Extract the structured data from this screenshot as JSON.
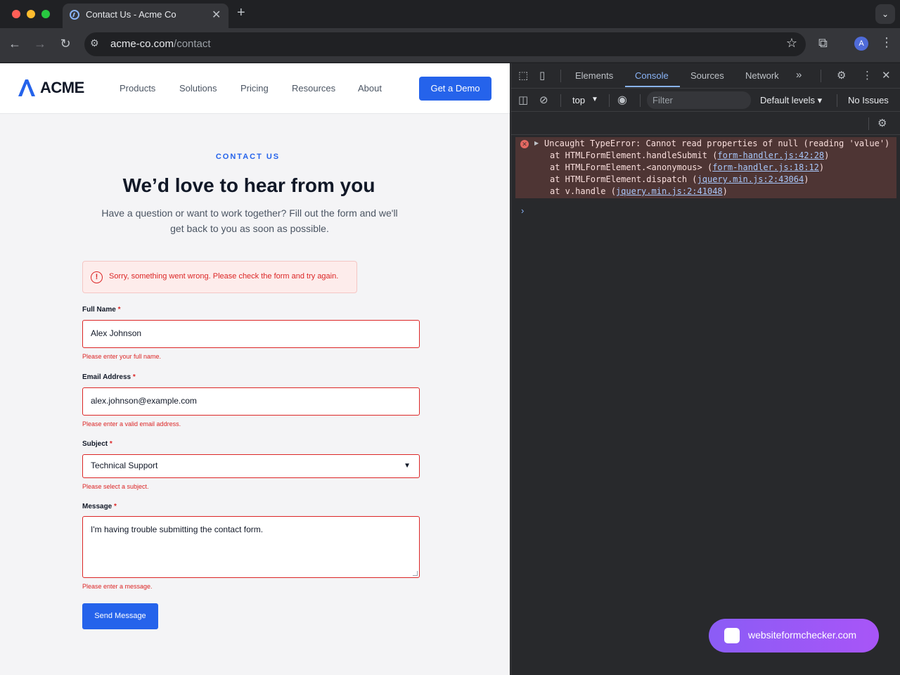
{
  "browser": {
    "tab_title": "Contact Us - Acme Co",
    "url_host": "acme-co.com",
    "url_path": "/contact",
    "avatar_letter": "A"
  },
  "site": {
    "logo_text": "ACME",
    "nav": [
      "Products",
      "Solutions",
      "Pricing",
      "Resources",
      "About"
    ],
    "cta_label": "Get a Demo",
    "brand_color": "#2563eb"
  },
  "hero": {
    "eyebrow": "CONTACT US",
    "title": "We’d love to hear from you",
    "subtitle": "Have a question or want to work together? Fill out the form and we'll get back to you as soon as possible."
  },
  "form": {
    "alert": "Sorry, something went wrong. Please check the form and try again.",
    "error_color": "#dc2626",
    "required_mark": "*",
    "full_name": {
      "label": "Full Name",
      "value": "Alex Johnson",
      "error": "Please enter your full name."
    },
    "email": {
      "label": "Email Address",
      "value": "alex.johnson@example.com",
      "error": "Please enter a valid email address."
    },
    "subject": {
      "label": "Subject",
      "value": "Technical Support",
      "error": "Please select a subject."
    },
    "message": {
      "label": "Message",
      "value": "I'm having trouble submitting the contact form.",
      "error": "Please enter a message."
    },
    "submit_label": "Send Message"
  },
  "devtools": {
    "tabs": [
      "Elements",
      "Console",
      "Sources",
      "Network"
    ],
    "active_tab": "Console",
    "context": "top",
    "filter_placeholder": "Filter",
    "levels": "Default levels",
    "issues": "No Issues",
    "error": {
      "message": "Uncaught TypeError: Cannot read properties of null (reading 'value')",
      "stack": [
        {
          "prefix": "at HTMLFormElement.handleSubmit (",
          "link": "form-handler.js:42:28",
          "suffix": ")"
        },
        {
          "prefix": "at HTMLFormElement.<anonymous> (",
          "link": "form-handler.js:18:12",
          "suffix": ")"
        },
        {
          "prefix": "at HTMLFormElement.dispatch (",
          "link": "jquery.min.js:2:43064",
          "suffix": ")"
        },
        {
          "prefix": "at v.handle (",
          "link": "jquery.min.js:2:41048",
          "suffix": ")"
        }
      ]
    },
    "prompt": "›"
  },
  "badge": {
    "text": "websiteformchecker.com"
  }
}
